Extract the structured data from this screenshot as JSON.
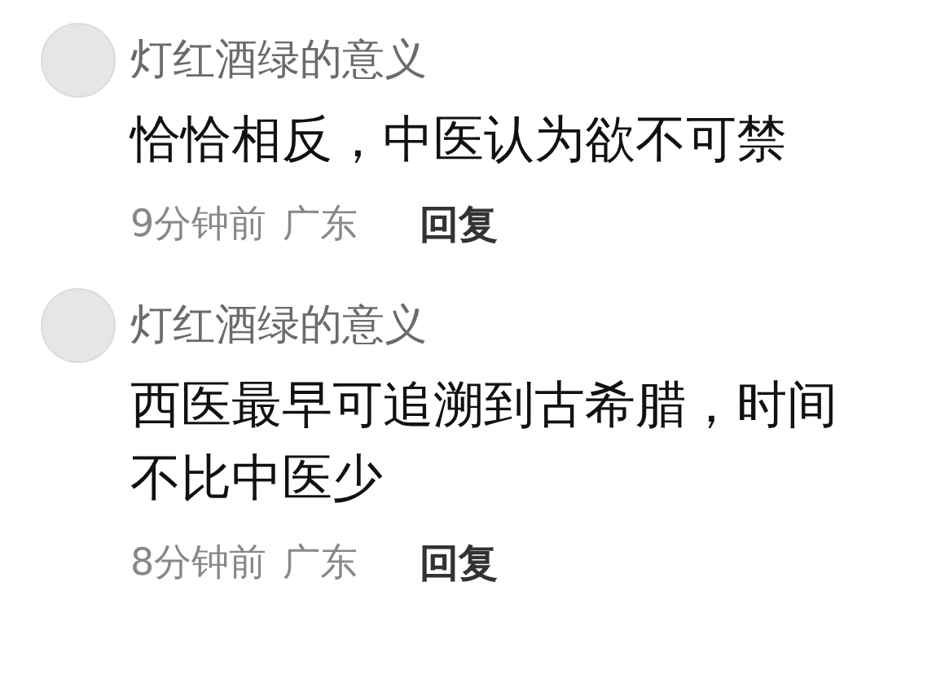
{
  "comments": [
    {
      "username": "灯红酒绿的意义",
      "content": "恰恰相反，中医认为欲不可禁",
      "time": "9分钟前",
      "location": "广东",
      "reply": "回复"
    },
    {
      "username": "灯红酒绿的意义",
      "content": "西医最早可追溯到古希腊，时间不比中医少",
      "time": "8分钟前",
      "location": "广东",
      "reply": "回复"
    }
  ]
}
